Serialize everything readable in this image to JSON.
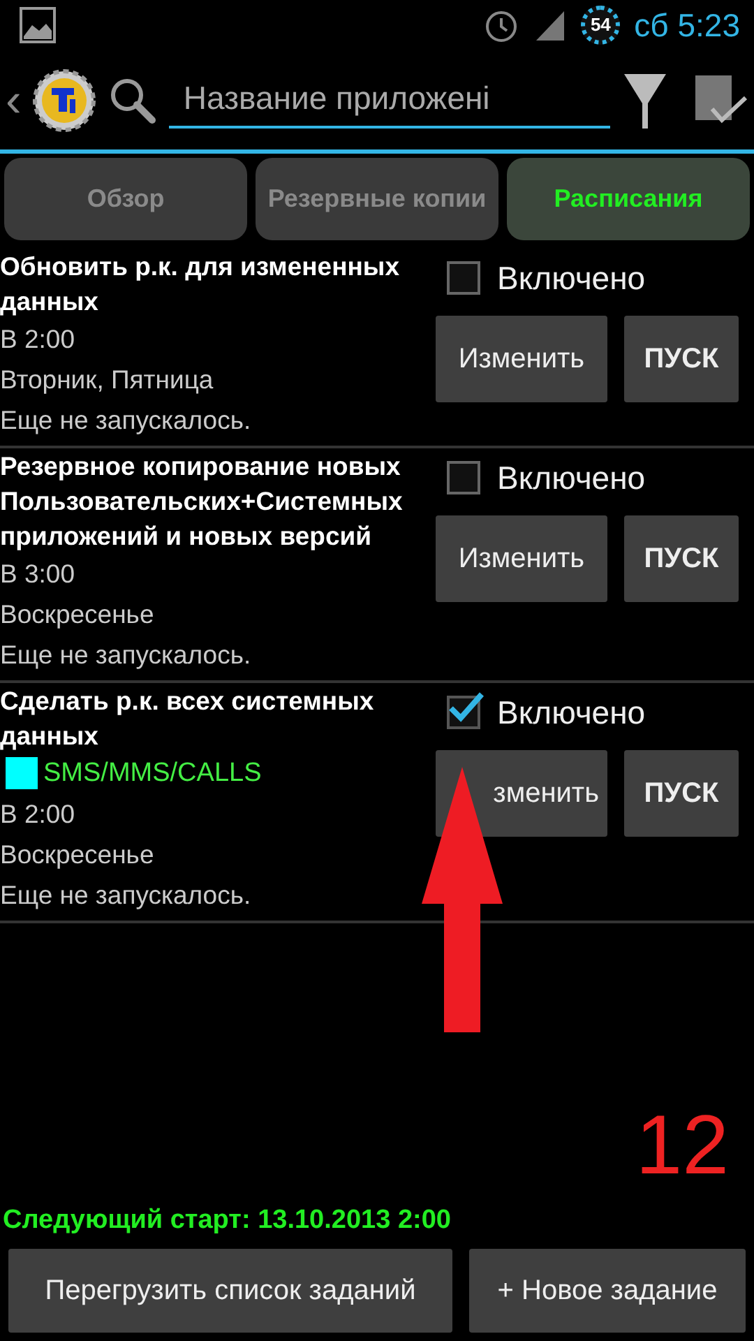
{
  "status_bar": {
    "badge": "54",
    "time": "сб 5:23"
  },
  "toolbar": {
    "back": "‹",
    "search": {
      "placeholder": "Название приложені"
    }
  },
  "tabs": [
    {
      "label": "Обзор",
      "selected": false
    },
    {
      "label": "Резервные копии",
      "selected": false
    },
    {
      "label": "Расписания",
      "selected": true
    }
  ],
  "tasks": [
    {
      "title": "Обновить р.к. для измененных данных",
      "lines": [
        "В 2:00",
        "Вторник, Пятница",
        "Еще не запускалось."
      ],
      "enabled_label": "Включено",
      "enabled": false,
      "edit": "Изменить",
      "run": "ПУСК"
    },
    {
      "title": "Резервное копирование новых Пользовательских+Системных приложений и новых версий",
      "lines": [
        "В 3:00",
        "Воскресенье",
        "Еще не запускалось."
      ],
      "enabled_label": "Включено",
      "enabled": false,
      "edit": "Изменить",
      "run": "ПУСК"
    },
    {
      "title": "Сделать р.к. всех системных данных",
      "tag": {
        "label": "SMS/MMS/CALLS",
        "color": "#00ffff"
      },
      "lines": [
        "В 2:00",
        "Воскресенье",
        "Еще не запускалось."
      ],
      "enabled_label": "Включено",
      "enabled": true,
      "edit": "зменить",
      "run": "ПУСК"
    }
  ],
  "annotation": {
    "number": "12"
  },
  "next_start": "Следующий старт: 13.10.2013 2:00",
  "buttons": [
    "Перегрузить список заданий",
    "+ Новое задание"
  ]
}
